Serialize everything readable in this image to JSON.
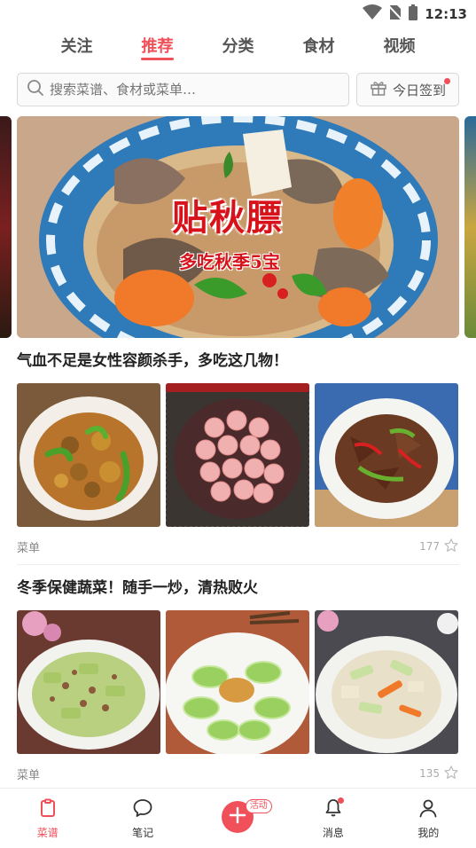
{
  "status_bar": {
    "time": "12:13",
    "icons": [
      "wifi-icon",
      "no-sim-icon",
      "battery-icon"
    ]
  },
  "top_tabs": [
    {
      "label": "关注",
      "active": false
    },
    {
      "label": "推荐",
      "active": true
    },
    {
      "label": "分类",
      "active": false
    },
    {
      "label": "食材",
      "active": false
    },
    {
      "label": "视频",
      "active": false
    }
  ],
  "search": {
    "placeholder": "搜索菜谱、食材或菜单…",
    "icon": "search-icon"
  },
  "signin": {
    "label": "今日签到",
    "icon": "gift-icon",
    "has_dot": true
  },
  "banner": {
    "title": "贴秋膘",
    "subtitle": "多吃秋季5宝"
  },
  "articles": [
    {
      "title": "气血不足是女性容颜杀手，多吃这几物！",
      "thumbs": [
        "stewed-chicken-with-chestnuts-photo",
        "pork-meatballs-photo",
        "stir-fried-liver-with-peppers-photo"
      ],
      "label": "菜单",
      "count": "177"
    },
    {
      "title": "冬季保健蔬菜！随手一炒，清热败火",
      "thumbs": [
        "stir-fried-lettuce-with-pork-photo",
        "garlic-lettuce-photo",
        "lettuce-and-carrot-photo"
      ],
      "label": "菜单",
      "count": "135"
    }
  ],
  "bottom_nav": [
    {
      "label": "菜谱",
      "icon": "recipe-icon",
      "active": true
    },
    {
      "label": "笔记",
      "icon": "chat-bubble-icon",
      "active": false
    },
    {
      "label": "",
      "icon": "plus-icon",
      "badge": "活动"
    },
    {
      "label": "消息",
      "icon": "bell-icon",
      "active": false,
      "has_dot": true
    },
    {
      "label": "我的",
      "icon": "user-icon",
      "active": false
    }
  ],
  "colors": {
    "accent": "#f0505a",
    "text": "#222222",
    "muted": "#888888"
  }
}
